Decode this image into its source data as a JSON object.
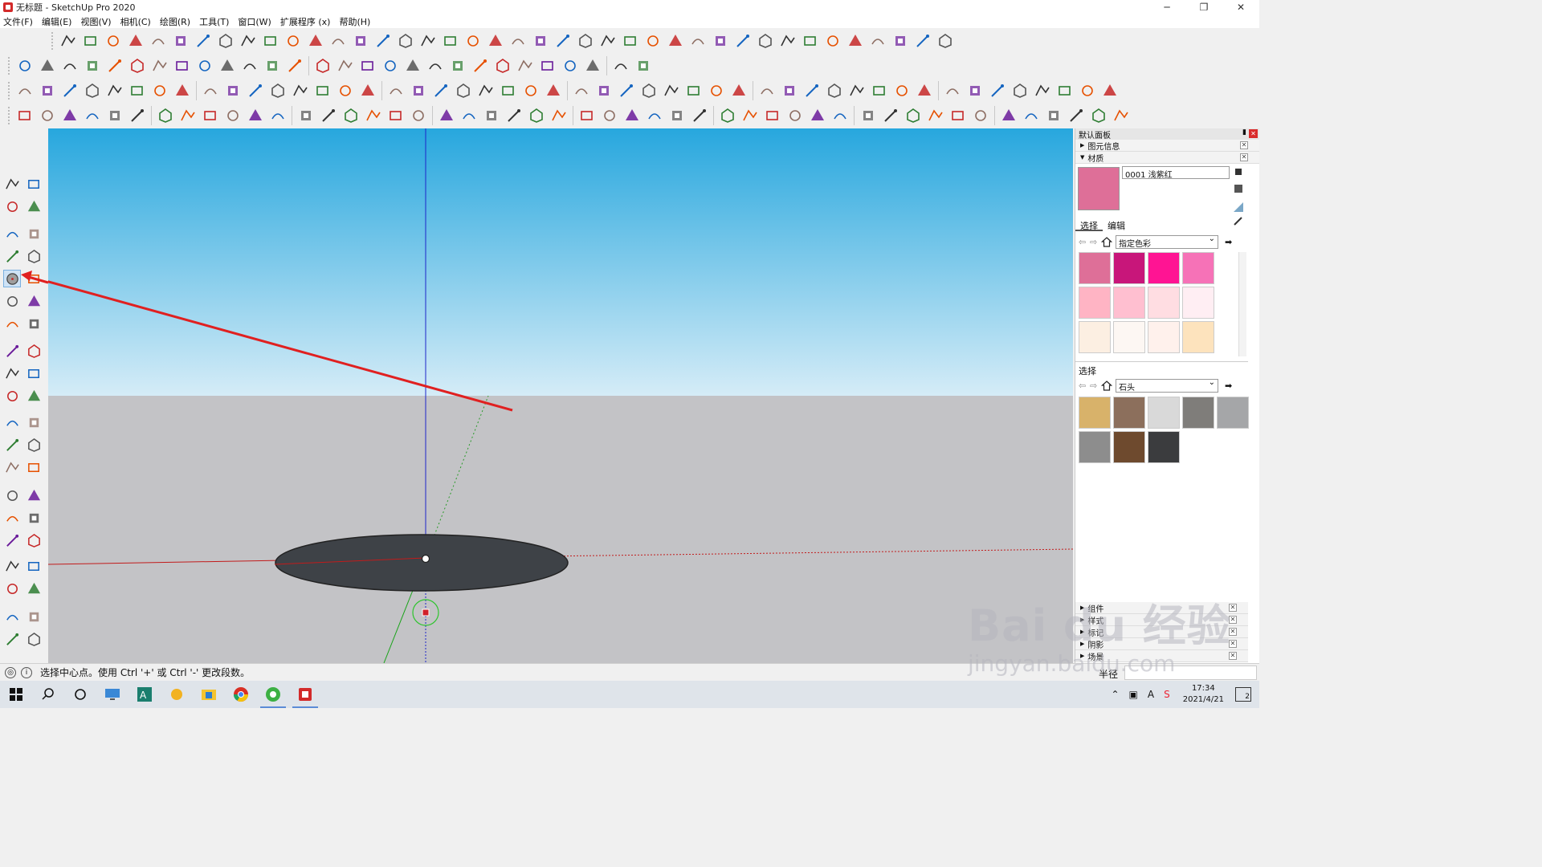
{
  "window": {
    "title": "无标题 - SketchUp Pro 2020",
    "minimize": "─",
    "maximize": "❐",
    "close": "✕"
  },
  "menu": [
    "文件(F)",
    "编辑(E)",
    "视图(V)",
    "相机(C)",
    "绘图(R)",
    "工具(T)",
    "窗口(W)",
    "扩展程序 (x)",
    "帮助(H)"
  ],
  "right_panel": {
    "header": "默认面板",
    "entity_info": "图元信息",
    "materials": "材质",
    "material_name": "0001 浅紫红",
    "tabs": [
      "选择",
      "编辑"
    ],
    "collection1": "指定色彩",
    "swatches1": [
      "#de6f98",
      "#c8167a",
      "#ff1493",
      "#f672b7",
      "#ffb4c4",
      "#ffbfd0",
      "#ffdde2",
      "#ffeef3",
      "#fcefe2",
      "#fdf7f3",
      "#fff1ec",
      "#fde3bd"
    ],
    "select_label": "选择",
    "collection2": "石头",
    "swatches2": [
      "#d8b26a",
      "#8c6f5c",
      "#d9d9d9",
      "#7f7d7a",
      "#a5a6a8",
      "#8d8d8d",
      "#6e4a2e",
      "#3b3c3e"
    ],
    "collapsed": [
      "组件",
      "样式",
      "标记",
      "阴影",
      "场景"
    ]
  },
  "status": {
    "message": "选择中心点。使用 Ctrl '+' 或 Ctrl '-' 更改段数。",
    "vcb_label": "半径"
  },
  "taskbar": {
    "time": "17:34",
    "date": "2021/4/21",
    "notif": "2"
  },
  "watermark": {
    "line1": "Bai du 经验",
    "line2": "jingyan.baidu.com"
  },
  "colors": {
    "x_axis": "#c21b1b",
    "y_axis": "#1aa31a",
    "z_axis": "#1d25c9",
    "annotation_arrow": "#e02020",
    "disc": "#3e4247"
  }
}
